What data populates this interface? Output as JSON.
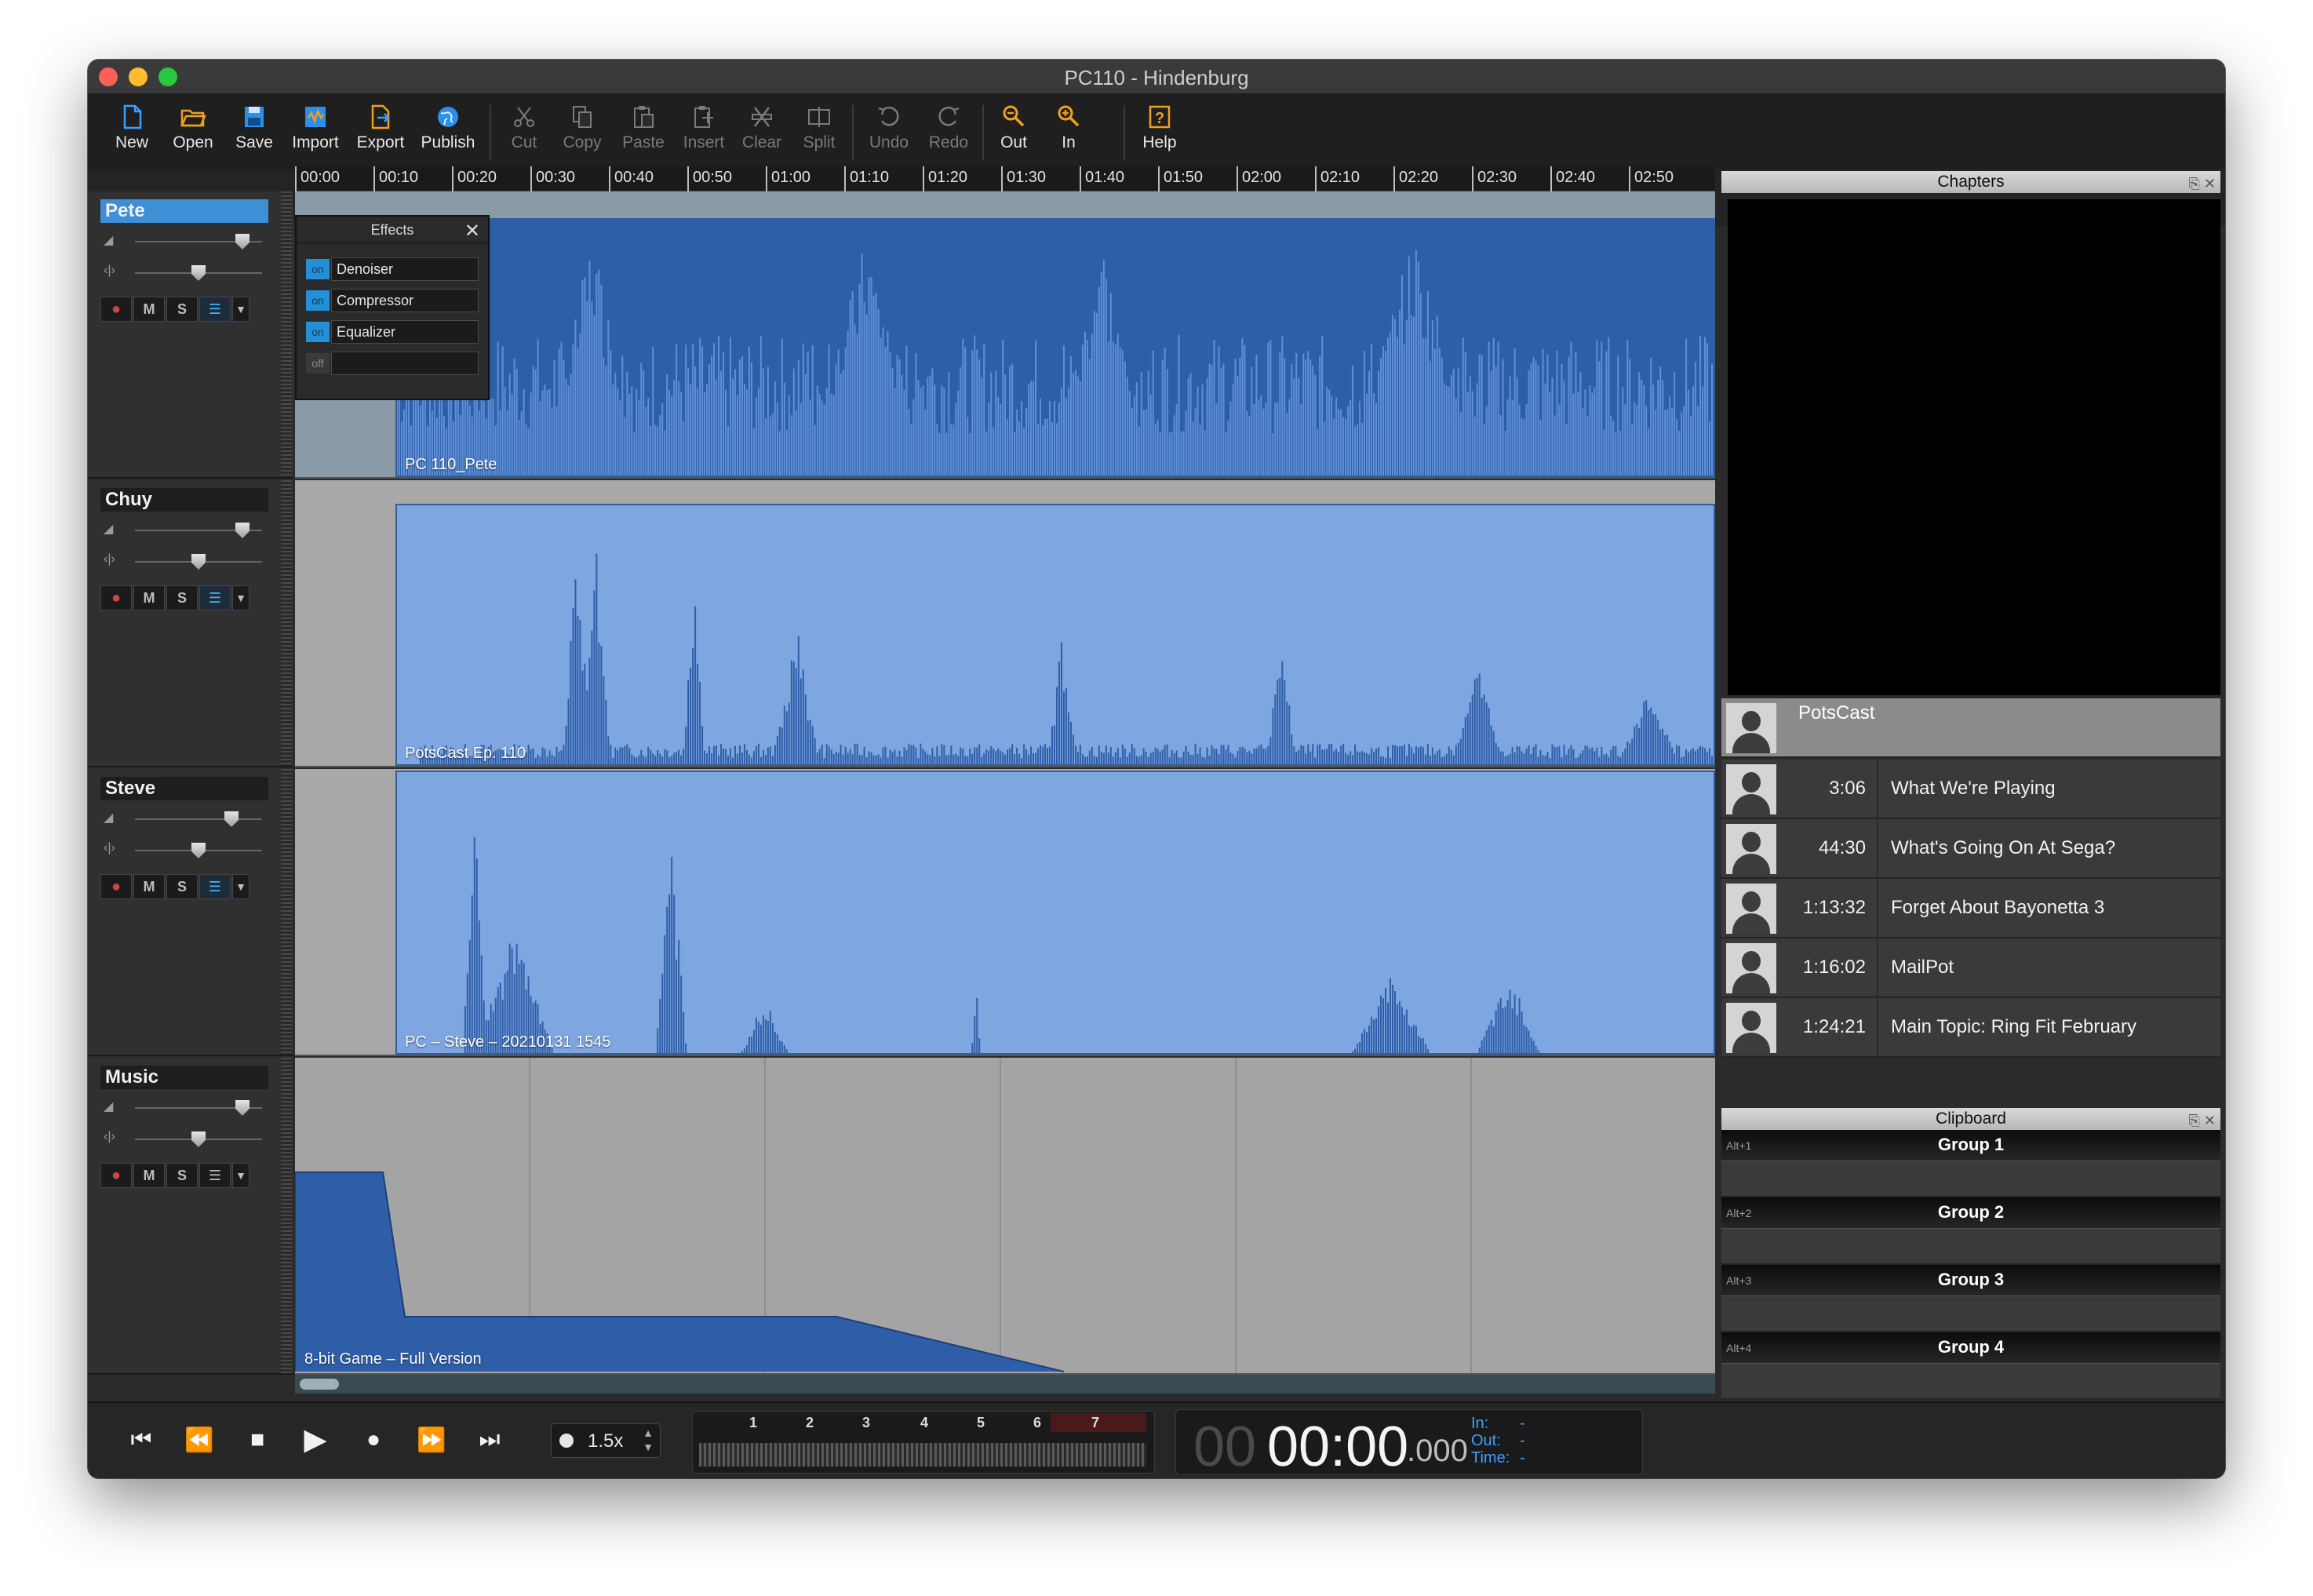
{
  "window": {
    "title": "PC110 - Hindenburg"
  },
  "toolbar": {
    "buttons": [
      {
        "label": "New",
        "icon": "new-file-icon",
        "enabled": true
      },
      {
        "label": "Open",
        "icon": "open-folder-icon",
        "enabled": true
      },
      {
        "label": "Save",
        "icon": "save-disk-icon",
        "enabled": true
      },
      {
        "label": "Import",
        "icon": "import-icon",
        "enabled": true
      },
      {
        "label": "Export",
        "icon": "export-icon",
        "enabled": true
      },
      {
        "label": "Publish",
        "icon": "globe-icon",
        "enabled": true
      },
      {
        "label": "Cut",
        "icon": "scissors-icon",
        "enabled": false
      },
      {
        "label": "Copy",
        "icon": "copy-icon",
        "enabled": false
      },
      {
        "label": "Paste",
        "icon": "paste-icon",
        "enabled": false
      },
      {
        "label": "Insert",
        "icon": "insert-icon",
        "enabled": false
      },
      {
        "label": "Clear",
        "icon": "clear-icon",
        "enabled": false
      },
      {
        "label": "Split",
        "icon": "split-icon",
        "enabled": false
      },
      {
        "label": "Undo",
        "icon": "undo-icon",
        "enabled": false
      },
      {
        "label": "Redo",
        "icon": "redo-icon",
        "enabled": false
      },
      {
        "label": "Out",
        "icon": "zoom-out-icon",
        "enabled": true
      },
      {
        "label": "In",
        "icon": "zoom-in-icon",
        "enabled": true
      },
      {
        "label": "Help",
        "icon": "help-icon",
        "enabled": true
      }
    ]
  },
  "ruler": {
    "ticks": [
      "00:00",
      "00:10",
      "00:20",
      "00:30",
      "00:40",
      "00:50",
      "01:00",
      "01:10",
      "01:20",
      "01:30",
      "01:40",
      "01:50",
      "02:00",
      "02:10",
      "02:20",
      "02:30",
      "02:40",
      "02:50"
    ]
  },
  "tracks": [
    {
      "name": "Pete",
      "selected": true,
      "clip_label": "PC 110_Pete"
    },
    {
      "name": "Chuy",
      "selected": false,
      "clip_label": "PotsCast Ep. 110"
    },
    {
      "name": "Steve",
      "selected": false,
      "clip_label": "PC – Steve – 20210131 1545"
    },
    {
      "name": "Music",
      "selected": false,
      "clip_label": "8-bit Game – Full Version"
    }
  ],
  "track_buttons": {
    "mute": "M",
    "solo": "S"
  },
  "effects": {
    "title": "Effects",
    "items": [
      {
        "state": "on",
        "name": "Denoiser"
      },
      {
        "state": "on",
        "name": "Compressor"
      },
      {
        "state": "on",
        "name": "Equalizer"
      },
      {
        "state": "off",
        "name": ""
      }
    ]
  },
  "chapters": {
    "title": "Chapters",
    "podcast_name": "PotsCast",
    "items": [
      {
        "time": "3:06",
        "title": "What We're Playing"
      },
      {
        "time": "44:30",
        "title": "What's Going On At Sega?"
      },
      {
        "time": "1:13:32",
        "title": "Forget About Bayonetta 3"
      },
      {
        "time": "1:16:02",
        "title": "MailPot"
      },
      {
        "time": "1:24:21",
        "title": "Main Topic: Ring Fit February"
      }
    ]
  },
  "clipboard": {
    "title": "Clipboard",
    "groups": [
      {
        "key": "Alt+1",
        "name": "Group 1"
      },
      {
        "key": "Alt+2",
        "name": "Group 2"
      },
      {
        "key": "Alt+3",
        "name": "Group 3"
      },
      {
        "key": "Alt+4",
        "name": "Group 4"
      }
    ]
  },
  "transport": {
    "speed": "1.5x",
    "meter_labels": [
      "1",
      "2",
      "3",
      "4",
      "5",
      "6",
      "7"
    ],
    "clock": {
      "hours": "00",
      "time": "00:00",
      "ms": ".000"
    },
    "in_label": "In:",
    "in_value": "-",
    "out_label": "Out:",
    "out_value": "-",
    "time_label": "Time:",
    "time_value": "-"
  },
  "colors": {
    "selected_track": "#3d8fd6",
    "clip_fill": "#7ea6e0",
    "waveform": "#2f5ea8",
    "effect_on": "#2190d9",
    "accent_toolbar": "#f0a020"
  }
}
